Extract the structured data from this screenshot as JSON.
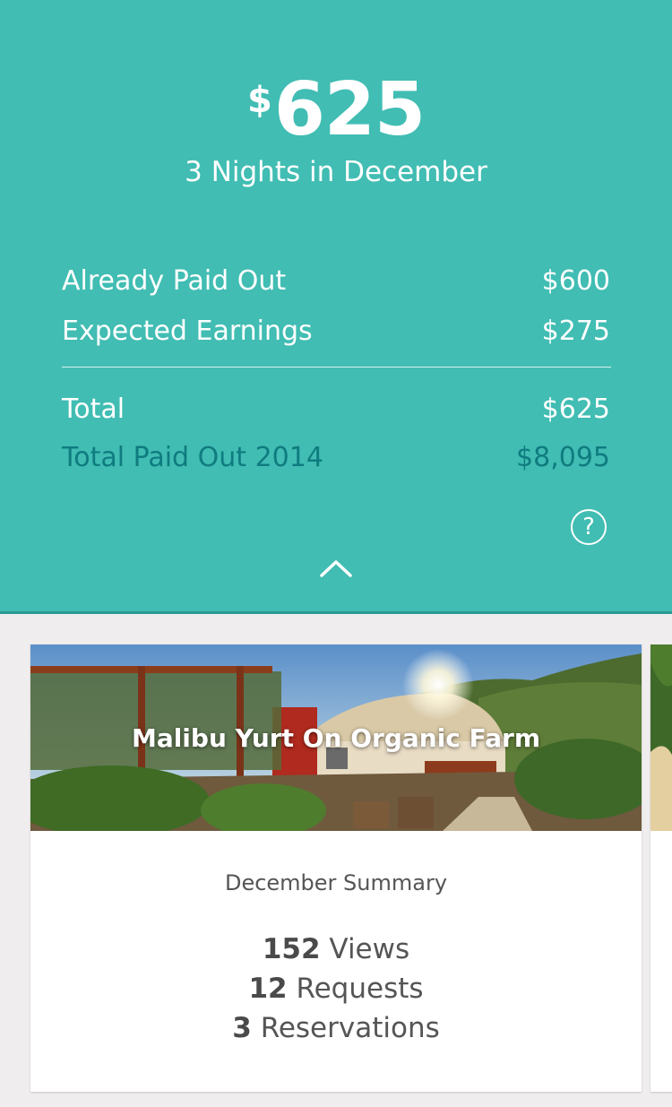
{
  "earnings": {
    "currency_symbol": "$",
    "amount": "625",
    "period": "3 Nights in December"
  },
  "breakdown": {
    "already_paid_out": {
      "label": "Already Paid Out",
      "value": "$600"
    },
    "expected_earnings": {
      "label": "Expected Earnings",
      "value": "$275"
    },
    "total": {
      "label": "Total",
      "value": "$625"
    },
    "total_paid_out_year": {
      "label": "Total Paid Out 2014",
      "value": "$8,095"
    }
  },
  "actions": {
    "help_label": "?",
    "help_icon": "question-circle-icon",
    "collapse_icon": "chevron-up-icon"
  },
  "listing_card": {
    "title": "Malibu Yurt On Organic Farm",
    "summary_title": "December Summary",
    "stats": [
      {
        "count": "152",
        "label": "Views"
      },
      {
        "count": "12",
        "label": "Requests"
      },
      {
        "count": "3",
        "label": "Reservations"
      }
    ]
  },
  "colors": {
    "header_bg": "#41bdb3",
    "accent_dark_teal": "#0f7c80",
    "page_bg": "#efeded"
  }
}
